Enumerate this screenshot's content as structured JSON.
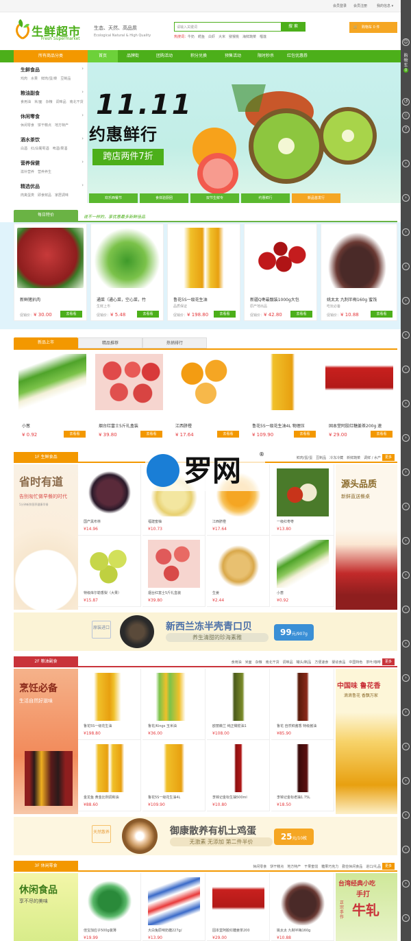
{
  "topbar": {
    "login": "会员登录",
    "register": "会员注册",
    "my": "我的信息 ▾"
  },
  "logo": {
    "cn": "生鲜超市",
    "en": "Fresh Supermarket"
  },
  "header": {
    "slogan": "生态、天然、高品质",
    "slogan_en": "Ecological Natural & High Quality",
    "search_placeholder": "请输入关键词",
    "search_btn": "搜 索",
    "hot_label": "热搜词：",
    "hot_words": "牛奶　鳕鱼　白虾　大米　猕猴桃　海鲜蔬菜　榴莲",
    "cart": "购物车 0 件"
  },
  "nav": {
    "cat": "所有商品分类",
    "items": [
      "首页",
      "品牌街",
      "团购活动",
      "积分兑换",
      "预售活动",
      "限时秒杀",
      "红包优惠券"
    ]
  },
  "menu": [
    {
      "h": "生鲜食品",
      "s": "鸡肉　水果　鲜肉/蛋/菜　豆制品"
    },
    {
      "h": "粮油副食",
      "s": "食用油　米/面　杂粮　调味品　南北干货"
    },
    {
      "h": "休闲零食",
      "s": "休闲零食　饼干糕点　地方特产"
    },
    {
      "h": "酒水茶饮",
      "s": "白酒　红/白葡萄酒　啤酒/果酒"
    },
    {
      "h": "营养保健",
      "s": "滋补营养　营养养生"
    },
    {
      "h": "精选优品",
      "s": "肉禽蛋类　即食鲜品　家居调味"
    }
  ],
  "banner": {
    "big": "11.11",
    "title": "约惠鲜行",
    "tag": "跨店两件7折",
    "tabs": [
      "欢乐西餐节",
      "食体验厨团",
      "双节生鲜专",
      "约惠鲜行",
      "新品首发行"
    ]
  },
  "daily": {
    "tag": "每日特价",
    "slogan": "说不一样的，享优惠最多新鲜佳品",
    "price_label": "促销价：",
    "go": "去看看",
    "items": [
      {
        "name": "新鲜猪扒肉",
        "sub": "",
        "price": "¥ 30.00"
      },
      {
        "name": "通菜（通心菜，空心菜，竹",
        "sub": "生鲜上市",
        "price": "¥ 5.48"
      },
      {
        "name": "鲁花5S一级花生油",
        "sub": "品质保证",
        "price": "¥ 198.80"
      },
      {
        "name": "新疆Q枣最靓装1000g大包",
        "sub": "原产地出品",
        "price": "¥ 42.80"
      },
      {
        "name": "姚太太 九制半梅160g 蜜饯",
        "sub": "吃玩必备",
        "price": "¥ 10.88"
      }
    ]
  },
  "newgoods": {
    "tabs": [
      "新品上市",
      "精品推荐",
      "热销排行"
    ],
    "go": "去看看",
    "items": [
      {
        "name": "小葱",
        "price": "¥ 0.92"
      },
      {
        "name": "烟台红富士5斤礼盒装",
        "price": "¥ 39.80"
      },
      {
        "name": "江西脐橙",
        "price": "¥ 17.64"
      },
      {
        "name": "鲁花5S一级花生油4L 物理压",
        "price": "¥ 109.90"
      },
      {
        "name": "固本堂阿胶红糖姜茶200g 速",
        "price": "¥ 29.00"
      }
    ]
  },
  "watermark": {
    "text": "罗网",
    "reg": "®"
  },
  "floor1": {
    "title": "1F 生鲜食品",
    "links": "鲜肉/蛋/蛋　豆制品　冷冻冷藏　新鲜蔬菜　调鲜 / 水产",
    "more": "更多",
    "left_title": "省时有道",
    "left_sub": "告别匆忙做早餐的时代",
    "left_sub2": "5分钟新鲜营养健康早餐",
    "right_title": "源头品质",
    "right_sub": "新鲜直送餐桌",
    "cells": [
      {
        "name": "国产黑布林",
        "price": "¥14.96"
      },
      {
        "name": "福建蜜柚",
        "price": "¥10.73"
      },
      {
        "name": "江西脐橙",
        "price": "¥17.64"
      },
      {
        "name": "一级红枣枣",
        "price": "¥13.80"
      },
      {
        "name": "特级库尔勒香梨（大果）",
        "price": "¥15.87"
      },
      {
        "name": "烟台红富士5斤礼盒装",
        "price": "¥39.80"
      },
      {
        "name": "生姜",
        "price": "¥2.44"
      },
      {
        "name": "小葱",
        "price": "¥0.92"
      }
    ]
  },
  "promo1": {
    "tag": "原装进口",
    "title": "新西兰冻半壳青口贝",
    "sub": "养生清甜的珍海素雅",
    "price": "99",
    "unit": "元/907g"
  },
  "floor2": {
    "title": "2F 粮油副食",
    "links": "食用油　米面　杂粮　南北干货　调味品　罐头/制品　方便速食　婴幼食品　中国特色　茶叶/咖啡",
    "more": "更多",
    "left_title": "烹饪必备",
    "left_sub": "生活自然好滋味",
    "right_title": "中国味 鲁花香",
    "right_sub": "滴滴鲁花 香飘万家",
    "cells": [
      {
        "name": "鲁花5S一级花生油",
        "price": "¥198.80"
      },
      {
        "name": "鲁花/Kings 玉米油",
        "price": "¥36.00"
      },
      {
        "name": "欧丽薇兰 纯正橄榄油1",
        "price": "¥108.00"
      },
      {
        "name": "鲁花 自然鲜酱香 特级酱油",
        "price": "¥85.90"
      },
      {
        "name": "金龙鱼 黄金比例调和油",
        "price": "¥88.60"
      },
      {
        "name": "鲁花5S一级花生油4L",
        "price": "¥109.90"
      },
      {
        "name": "李锦记金标生抽500ml",
        "price": "¥10.80"
      },
      {
        "name": "李锦记金标老抽1.75L",
        "price": "¥18.50"
      }
    ]
  },
  "promo2": {
    "tag": "天然散养",
    "title": "御康散养有机土鸡蛋",
    "sub": "无激素 无添加 第二件半价",
    "price": "25",
    "unit": "元/10枚"
  },
  "floor3": {
    "title": "3F 休闲零食",
    "links": "休闲零食　饼干糕点　地方特产　干果蜜饯　糖果巧克力　勤俭休闲食品　进口/礼品",
    "more": "更多",
    "left_title": "休闲食品",
    "left_sub": "享不尽的美味",
    "right_title": "台湾经典小吃",
    "right_sub": "手打",
    "right_big": "牛轧",
    "right_side": "正宗手作",
    "cells": [
      {
        "name": "佳宝加应子500g装薄",
        "price": "¥19.99"
      },
      {
        "name": "大白兔原味奶糖227g/",
        "price": "¥13.90"
      },
      {
        "name": "固本堂阿胶红糖姜茶200",
        "price": "¥29.00"
      },
      {
        "name": "姚太太 九制半梅160g",
        "price": "¥10.88"
      }
    ]
  },
  "colors": {
    "green": "#4caf1a",
    "orange": "#f39800",
    "red": "#e4393c",
    "rail": "#4a4a4a"
  },
  "rail": {
    "cart": "购物车",
    "cart_count": "0"
  }
}
